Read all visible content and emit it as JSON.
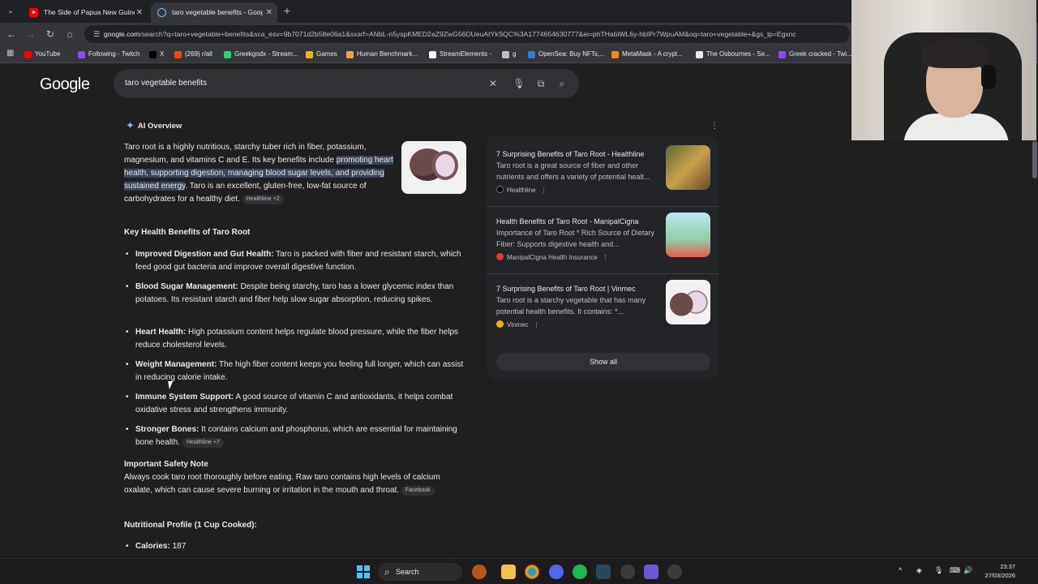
{
  "browser": {
    "tabs": [
      {
        "label": "The Side of Papua New Guinea",
        "icon": "youtube-icon"
      },
      {
        "label": "taro vegetable benefits - Google",
        "icon": "google-icon"
      }
    ],
    "url_host": "google.com",
    "url_rest": "/search?q=taro+vegetable+benefits&sca_esv=9b7071d2b58e06a1&sxsrf=ANbL-n5yspKMED2aZ9ZwG56DUeuAtYkSQC%3A1774654630777&ei=phTHabiWL6y-hbIPr7WpuAM&oq=taro+vegetable+&gs_lp=Egxnc",
    "bookmarks": [
      {
        "label": "YouTube",
        "color": "#ff0000"
      },
      {
        "label": "Following - Twitch",
        "color": "#9146ff"
      },
      {
        "label": "X",
        "color": "#000000"
      },
      {
        "label": "(269) r/all",
        "color": "#ff4500"
      },
      {
        "label": "Greekgodx - Stream...",
        "color": "#2bd46b"
      },
      {
        "label": "Games",
        "color": "#f4b400"
      },
      {
        "label": "Human Benchmark...",
        "color": "#f5a623"
      },
      {
        "label": "StreamElements -",
        "color": "#ffffff"
      },
      {
        "label": "g",
        "color": "#bdc1c6"
      },
      {
        "label": "OpenSea: Buy NFTs,...",
        "color": "#2081e2"
      },
      {
        "label": "MetaMask - A crypt...",
        "color": "#f6851b"
      },
      {
        "label": "The Osbournes - Se...",
        "color": "#e8eaed"
      },
      {
        "label": "Greek cracked - Twi...",
        "color": "#9146ff"
      }
    ]
  },
  "search": {
    "query": "taro vegetable benefits"
  },
  "ai_overview": {
    "label": "AI Overview",
    "intro_a": "Taro root is a highly nutritious, starchy tuber rich in fiber, potassium, magnesium, and vitamins C and E. Its key benefits include ",
    "intro_highlight": "promoting heart health, supporting digestion, managing blood sugar levels, and providing sustained energy",
    "intro_b": ". Taro is an excellent, gluten-free, low-fat source of carbohydrates for a healthy diet.",
    "intro_chip": "Healthline +2",
    "key_heading": "Key Health Benefits of Taro Root",
    "benefits": [
      {
        "title": "Improved Digestion and Gut Health:",
        "text": " Taro is packed with fiber and resistant starch, which feed good gut bacteria and improve overall digestive function."
      },
      {
        "title": "Blood Sugar Management:",
        "text": " Despite being starchy, taro has a lower glycemic index than potatoes. Its resistant starch and fiber help slow sugar absorption, reducing spikes."
      },
      {
        "title": "Heart Health:",
        "text": " High potassium content helps regulate blood pressure, while the fiber helps reduce cholesterol levels."
      },
      {
        "title": "Weight Management:",
        "text": " The high fiber content keeps you feeling full longer, which can assist in reducing calorie intake."
      },
      {
        "title": "Immune System Support:",
        "text": " A good source of vitamin C and antioxidants, it helps combat oxidative stress and strengthens immunity."
      },
      {
        "title": "Stronger Bones:",
        "text": " It contains calcium and phosphorus, which are essential for maintaining bone health.",
        "chip": "Healthline +7"
      }
    ],
    "safety_heading": "Important Safety Note",
    "safety_text": "Always cook taro root thoroughly before eating. Raw taro contains high levels of calcium oxalate, which can cause severe burning or irritation in the mouth and throat.",
    "safety_chip": "Facebook",
    "nutrition_heading": "Nutritional Profile (1 Cup Cooked):",
    "calories_label": "Calories:",
    "calories_value": " 187"
  },
  "sources": [
    {
      "title": "7 Surprising Benefits of Taro Root - Healthline",
      "desc": "Taro root is a great source of fiber and other nutrients and offers a variety of potential healt...",
      "site": "Healthline",
      "color": "#000000"
    },
    {
      "title": "Health Benefits of Taro Root - ManipalCigna",
      "desc": "Importance of Taro Root * Rich Source of Dietary Fiber: Supports digestive health and...",
      "site": "ManipalCigna Health Insurance",
      "color": "#e53935"
    },
    {
      "title": "7 Surprising Benefits of Taro Root | Vinmec",
      "desc": "Taro root is a starchy vegetable that has many potential health benefits. It contains: *...",
      "site": "Vinmec",
      "color": "#f4b400"
    }
  ],
  "show_all": "Show all",
  "taskbar": {
    "search_label": "Search",
    "time": "23:37",
    "date": "27/03/2026"
  }
}
